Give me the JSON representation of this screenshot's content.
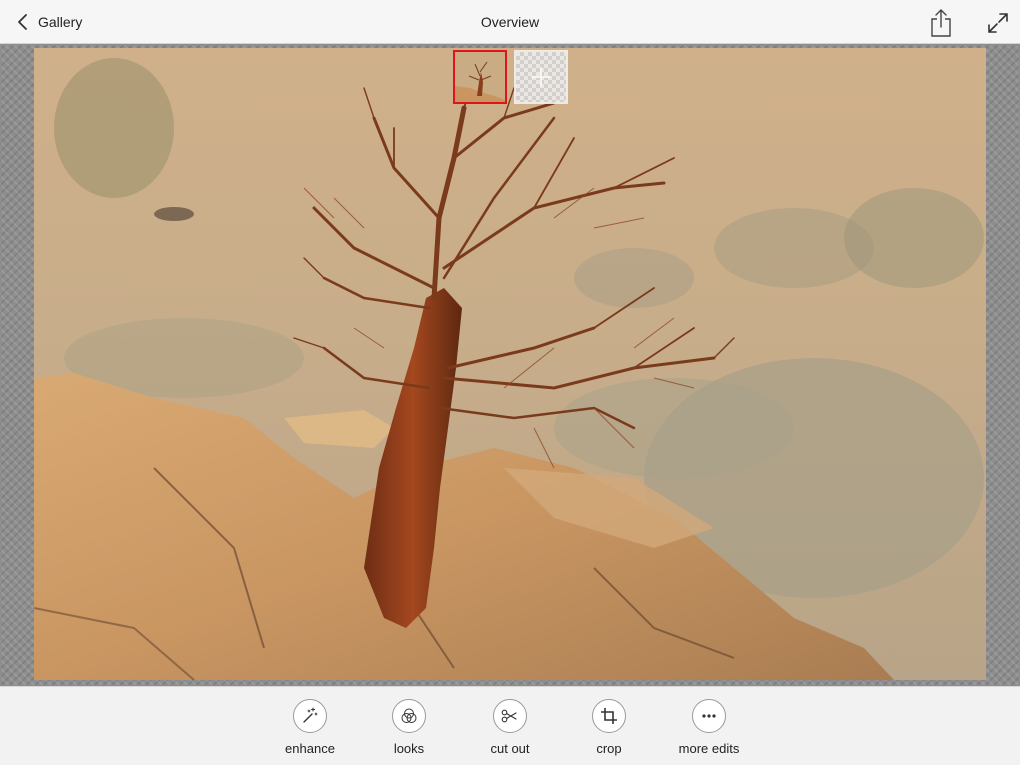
{
  "topbar": {
    "back_label": "Gallery",
    "title": "Overview",
    "share_icon": "share-icon",
    "expand_icon": "expand-icon"
  },
  "canvas": {
    "photo_description_icon": "tree-photo",
    "layers": [
      {
        "name": "layer-1",
        "selected": true
      },
      {
        "name": "add-layer",
        "icon": "plus-icon"
      }
    ]
  },
  "toolbar": {
    "items": [
      {
        "label": "enhance",
        "icon": "magic-wand-icon"
      },
      {
        "label": "looks",
        "icon": "looks-circles-icon"
      },
      {
        "label": "cut out",
        "icon": "scissors-icon"
      },
      {
        "label": "crop",
        "icon": "crop-icon"
      },
      {
        "label": "more edits",
        "icon": "more-dots-icon"
      }
    ]
  },
  "colors": {
    "accent_selected": "#e0141a",
    "bar_bg": "#f6f6f7"
  }
}
